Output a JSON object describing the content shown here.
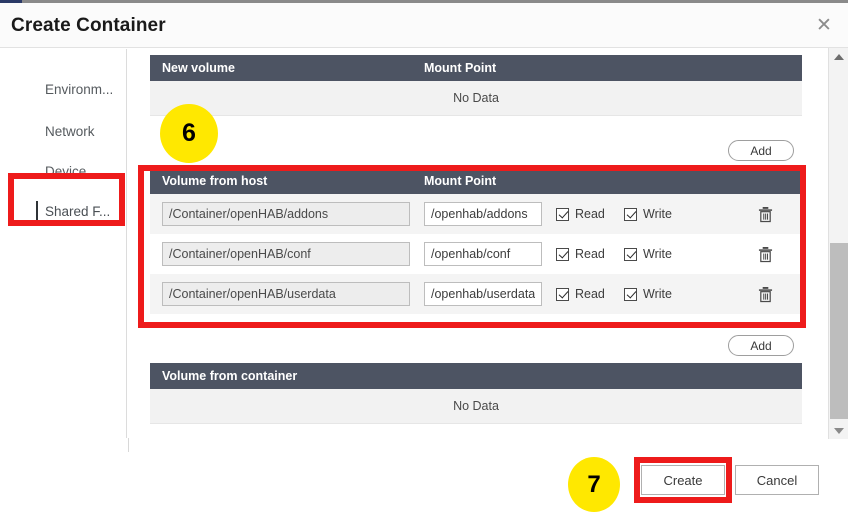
{
  "dialog": {
    "title": "Create Container",
    "close_icon": "close-icon"
  },
  "sidebar": {
    "items": [
      {
        "label": "Environm...",
        "active": false
      },
      {
        "label": "Network",
        "active": false
      },
      {
        "label": "Device",
        "active": false
      },
      {
        "label": "Shared F...",
        "active": true
      }
    ]
  },
  "sections": {
    "new_volume": {
      "headers": {
        "host": "New volume",
        "mount": "Mount Point"
      },
      "empty_text": "No Data",
      "add_label": "Add"
    },
    "volume_from_host": {
      "headers": {
        "host": "Volume from host",
        "mount": "Mount Point"
      },
      "add_label": "Add",
      "rows": [
        {
          "host_path": "/Container/openHAB/addons",
          "mount_point": "/openhab/addons",
          "read_label": "Read",
          "read_checked": true,
          "write_label": "Write",
          "write_checked": true,
          "delete_icon": "trash-icon"
        },
        {
          "host_path": "/Container/openHAB/conf",
          "mount_point": "/openhab/conf",
          "read_label": "Read",
          "read_checked": true,
          "write_label": "Write",
          "write_checked": true,
          "delete_icon": "trash-icon"
        },
        {
          "host_path": "/Container/openHAB/userdata",
          "mount_point": "/openhab/userdata",
          "read_label": "Read",
          "read_checked": true,
          "write_label": "Write",
          "write_checked": true,
          "delete_icon": "trash-icon"
        }
      ]
    },
    "volume_from_container": {
      "headers": {
        "host": "Volume from container"
      },
      "empty_text": "No Data"
    }
  },
  "footer": {
    "create_label": "Create",
    "cancel_label": "Cancel"
  },
  "scrollbar": {
    "up_icon": "triangle-up-icon",
    "down_icon": "triangle-down-icon"
  },
  "annotations": {
    "markers": [
      {
        "number": "6"
      },
      {
        "number": "7"
      }
    ],
    "highlight_color": "#ee1b1b",
    "marker_color": "#ffe800"
  }
}
